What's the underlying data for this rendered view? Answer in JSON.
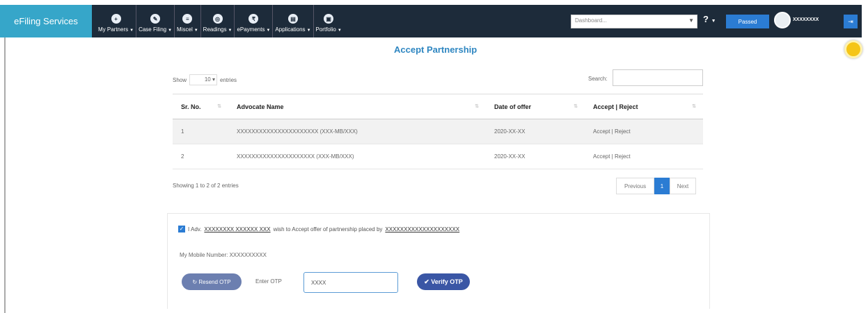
{
  "brand": "eFiling Services",
  "nav": [
    {
      "label": "My Partners",
      "icon": "partners-icon"
    },
    {
      "label": "Case Filing",
      "icon": "edit-icon"
    },
    {
      "label": "Miscel",
      "icon": "list-icon"
    },
    {
      "label": "Readings",
      "icon": "book-icon"
    },
    {
      "label": "ePayments",
      "icon": "payment-icon"
    },
    {
      "label": "Applications",
      "icon": "applications-icon"
    },
    {
      "label": "Portfolio",
      "icon": "portfolio-icon"
    }
  ],
  "header": {
    "select_placeholder": "Dashboard...",
    "help": "?",
    "pass_button": "Passed",
    "user_name": "XXXXXXXX",
    "logout_icon": "logout-icon"
  },
  "page_title": "Accept Partnership",
  "table_controls": {
    "show_label": "Show",
    "show_value": "10",
    "entries_label": "entries",
    "search_label": "Search:"
  },
  "table": {
    "headers": [
      "Sr. No.",
      "Advocate Name",
      "Date of offer",
      "Accept | Reject"
    ],
    "rows": [
      {
        "sr": "1",
        "name": "XXXXXXXXXXXXXXXXXXXXXX (XXX-MB/XXX)",
        "date": "2020-XX-XX",
        "action": "Accept | Reject"
      },
      {
        "sr": "2",
        "name": "XXXXXXXXXXXXXXXXXXXXX (XXX-MB/XXX)",
        "date": "2020-XX-XX",
        "action": "Accept | Reject"
      }
    ]
  },
  "table_info": "Showing 1 to 2 of 2 entries",
  "pager": {
    "previous": "Previous",
    "current": "1",
    "next": "Next"
  },
  "consent": {
    "prefix": "I Adv.",
    "self_name": "XXXXXXXX XXXXXX XXX",
    "middle": "wish to Accept offer of partnership placed by",
    "offerer_name": "XXXXXXXXXXXXXXXXXXXX",
    "mobile_label": "My Mobile Number: XXXXXXXXXX"
  },
  "otp": {
    "resend_label": "Resend OTP",
    "enter_label": "Enter OTP",
    "value": "XXXX",
    "verify_label": "Verify OTP"
  }
}
